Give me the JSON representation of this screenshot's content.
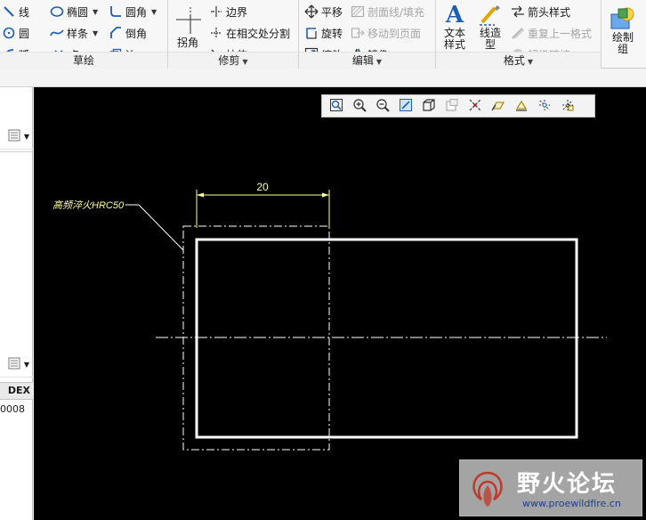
{
  "ribbon": {
    "sketch": {
      "label": "草绘",
      "line": "线",
      "ellipse": "椭圆",
      "fillet": "圆角",
      "circle": "圆",
      "spline": "样条",
      "chamfer": "倒角",
      "arc": "弧",
      "point": "点",
      "edge": "边"
    },
    "trim": {
      "label": "修剪",
      "corner": "拐角",
      "boundary": "边界",
      "divide_at_intersect": "在相交处分割",
      "stretch": "拉伸"
    },
    "edit": {
      "label": "编辑",
      "translate": "平移",
      "rotate": "旋转",
      "scale": "缩放",
      "xhatch_fill": "剖面线/填充",
      "move_to_page": "移动到页面",
      "mirror": "镜像"
    },
    "format": {
      "label": "格式",
      "text_style": "文本\n样式",
      "line_style": "线造\n型",
      "arrow_style": "箭头样式",
      "repeat_format": "重复上一格式",
      "hyperlink": "超级链接"
    },
    "draw": {
      "draw_group": "绘制\n组"
    }
  },
  "sidepanel": {
    "header": "DEX",
    "cell": "0008"
  },
  "drawing": {
    "dimension_value": "20",
    "note_text": "高频淬火HRC50"
  },
  "watermark": {
    "title": "野火论坛",
    "url": "www.proewildfire.cn"
  },
  "colors": {
    "canvas_bg": "#000000",
    "geometry": "#ffffff",
    "annotation": "#ffff99",
    "ribbon_bg": "#f7f7f7",
    "accent_blue": "#1e5fb4"
  }
}
